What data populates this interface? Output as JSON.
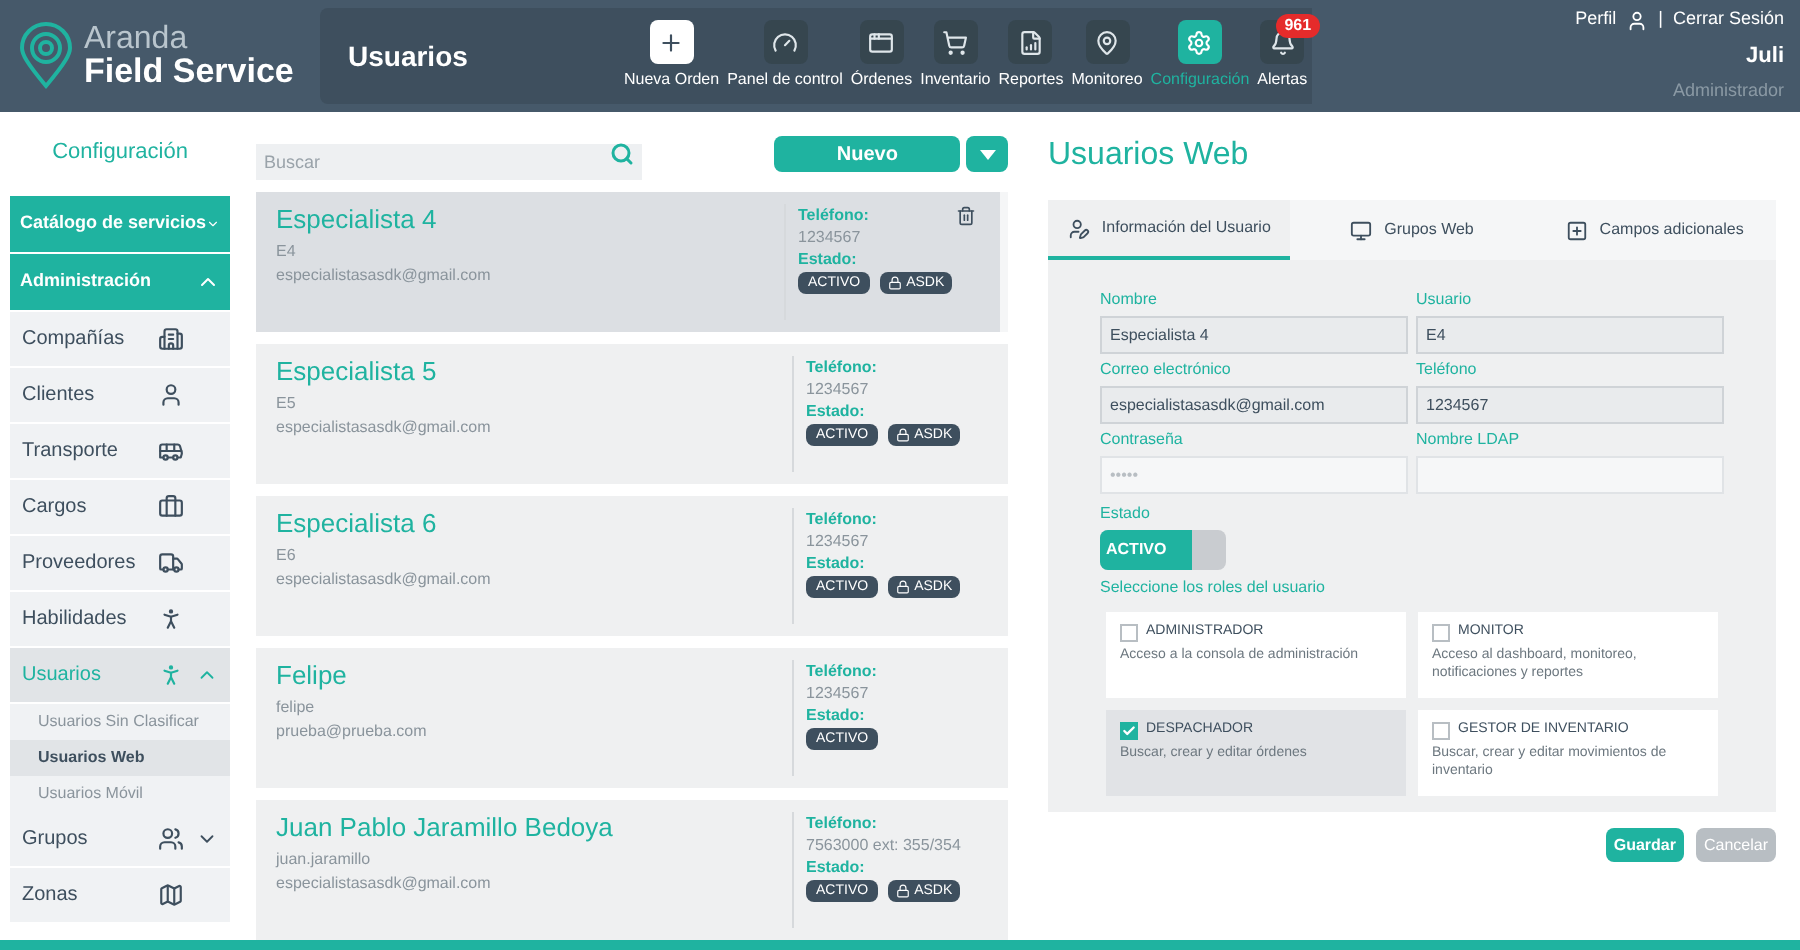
{
  "header": {
    "logo": {
      "line1": "Aranda",
      "line2": "Field Service"
    },
    "page_title": "Usuarios",
    "nav": [
      {
        "label": "Nueva Orden",
        "selected": false
      },
      {
        "label": "Panel de control",
        "selected": false
      },
      {
        "label": "Órdenes",
        "selected": false
      },
      {
        "label": "Inventario",
        "selected": false
      },
      {
        "label": "Reportes",
        "selected": false
      },
      {
        "label": "Monitoreo",
        "selected": false
      },
      {
        "label": "Configuración",
        "selected": true
      },
      {
        "label": "Alertas",
        "selected": false,
        "badge": "961"
      }
    ],
    "user": {
      "profile": "Perfil",
      "separator": "|",
      "logout": "Cerrar Sesión",
      "name": "Juli",
      "role": "Administrador"
    }
  },
  "sidebar": {
    "title": "Configuración",
    "items": [
      {
        "kind": "header",
        "label": "Catálogo de servicios",
        "expanded": false
      },
      {
        "kind": "header",
        "label": "Administración",
        "expanded": true
      },
      {
        "kind": "item",
        "label": "Compañías",
        "selected": false
      },
      {
        "kind": "item",
        "label": "Clientes",
        "selected": false
      },
      {
        "kind": "item",
        "label": "Transporte",
        "selected": false
      },
      {
        "kind": "item",
        "label": "Cargos",
        "selected": false
      },
      {
        "kind": "item",
        "label": "Proveedores",
        "selected": false
      },
      {
        "kind": "item",
        "label": "Habilidades",
        "selected": false
      },
      {
        "kind": "item",
        "label": "Usuarios",
        "selected": true,
        "expanded": true,
        "children": [
          {
            "label": "Usuarios Sin Clasificar",
            "selected": false
          },
          {
            "label": "Usuarios Web",
            "selected": true
          },
          {
            "label": "Usuarios Móvil",
            "selected": false
          }
        ]
      },
      {
        "kind": "item",
        "label": "Grupos",
        "selected": false,
        "expanded": false
      },
      {
        "kind": "item",
        "label": "Zonas",
        "selected": false
      }
    ]
  },
  "list": {
    "search": {
      "placeholder": "Buscar"
    },
    "new_button": "Nuevo",
    "users": [
      {
        "name": "Especialista 4",
        "login": "E4",
        "email": "especialistasasdk@gmail.com",
        "phone_label": "Teléfono:",
        "phone": "1234567",
        "status_label": "Estado:",
        "status": "ACTIVO",
        "tag": "ASDK",
        "selected": true
      },
      {
        "name": "Especialista 5",
        "login": "E5",
        "email": "especialistasasdk@gmail.com",
        "phone_label": "Teléfono:",
        "phone": "1234567",
        "status_label": "Estado:",
        "status": "ACTIVO",
        "tag": "ASDK",
        "selected": false
      },
      {
        "name": "Especialista 6",
        "login": "E6",
        "email": "especialistasasdk@gmail.com",
        "phone_label": "Teléfono:",
        "phone": "1234567",
        "status_label": "Estado:",
        "status": "ACTIVO",
        "tag": "ASDK",
        "selected": false
      },
      {
        "name": "Felipe",
        "login": "felipe",
        "email": "prueba@prueba.com",
        "phone_label": "Teléfono:",
        "phone": "1234567",
        "status_label": "Estado:",
        "status": "ACTIVO",
        "selected": false
      },
      {
        "name": "Juan Pablo Jaramillo Bedoya",
        "login": "juan.jaramillo",
        "email": "especialistasasdk@gmail.com",
        "phone_label": "Teléfono:",
        "phone": "7563000 ext: 355/354",
        "status_label": "Estado:",
        "status": "ACTIVO",
        "tag": "ASDK",
        "selected": false
      }
    ]
  },
  "detail": {
    "title": "Usuarios Web",
    "tabs": [
      {
        "label": "Información del Usuario",
        "selected": true
      },
      {
        "label": "Grupos Web",
        "selected": false
      },
      {
        "label": "Campos adicionales",
        "selected": false
      }
    ],
    "fields": [
      {
        "label": "Nombre",
        "value": "Especialista 4",
        "disabled": false
      },
      {
        "label": "Usuario",
        "value": "E4",
        "disabled": false
      },
      {
        "label": "Correo electrónico",
        "value": "especialistasasdk@gmail.com",
        "disabled": false
      },
      {
        "label": "Teléfono",
        "value": "1234567",
        "disabled": false
      },
      {
        "label": "Contraseña",
        "placeholder": "•••••",
        "disabled": true
      },
      {
        "label": "Nombre LDAP",
        "disabled": true
      }
    ],
    "status_label": "Estado",
    "status_toggle": {
      "label": "ACTIVO",
      "on": true
    },
    "roles_label": "Seleccione los roles del usuario",
    "roles": [
      {
        "name": "ADMINISTRADOR",
        "description": "Acceso a la consola de administración",
        "checked": false
      },
      {
        "name": "MONITOR",
        "description": "Acceso al dashboard, monitoreo, notificaciones y reportes",
        "checked": false
      },
      {
        "name": "DESPACHADOR",
        "description": "Buscar, crear y editar órdenes",
        "checked": true
      },
      {
        "name": "GESTOR DE INVENTARIO",
        "description": "Buscar, crear y editar movimientos de inventario",
        "checked": false
      }
    ],
    "save_button": "Guardar",
    "cancel_button": {
      "label": "Cancelar",
      "disabled": true
    }
  }
}
